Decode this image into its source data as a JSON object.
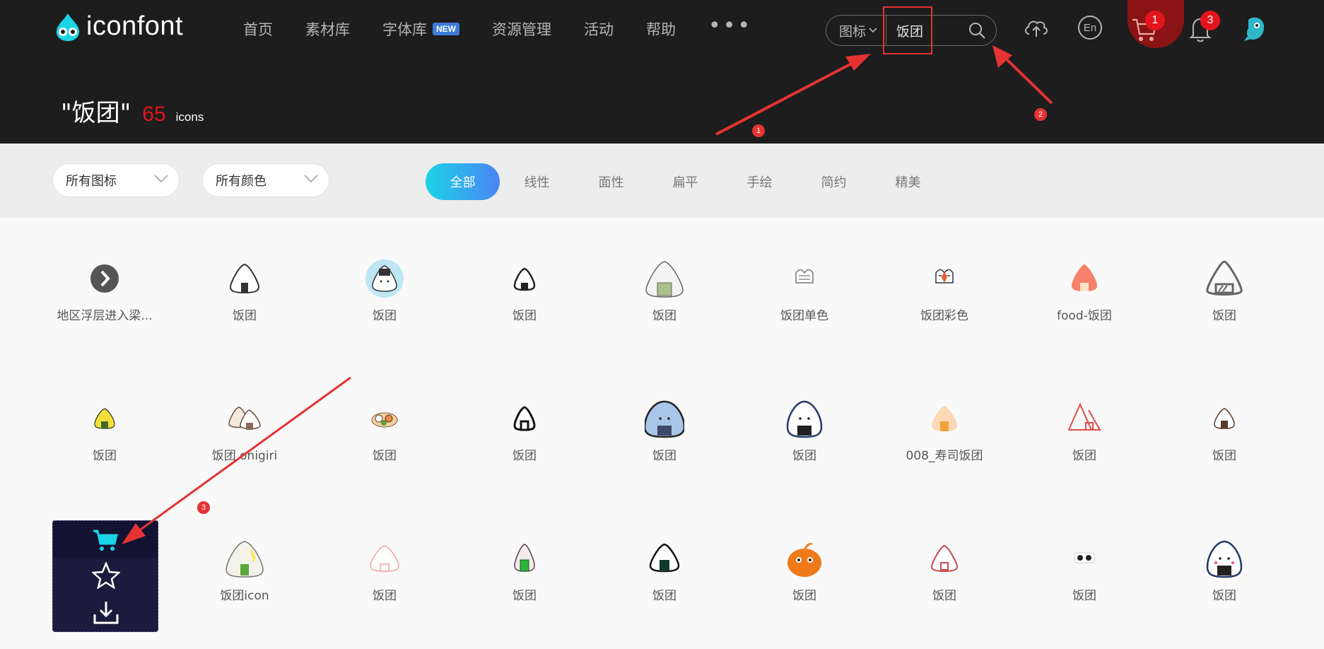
{
  "header": {
    "logo_text": "iconfont",
    "nav": [
      {
        "label": "首页"
      },
      {
        "label": "素材库"
      },
      {
        "label": "字体库",
        "badge": "NEW"
      },
      {
        "label": "资源管理"
      },
      {
        "label": "活动"
      },
      {
        "label": "帮助"
      }
    ],
    "more_label": "•••",
    "search": {
      "type_label": "图标",
      "value": "饭团"
    },
    "lang_label": "En",
    "cart_count": "1",
    "notification_count": "3"
  },
  "result": {
    "query": "\"饭团\"",
    "count": "65",
    "unit": "icons"
  },
  "annotations": [
    "1",
    "2",
    "3"
  ],
  "filters": {
    "type_dropdown": "所有图标",
    "color_dropdown": "所有颜色",
    "tabs": [
      "全部",
      "线性",
      "面性",
      "扁平",
      "手绘",
      "简约",
      "精美"
    ],
    "active_tab": "全部"
  },
  "icons": [
    {
      "label": "地区浮层进入梁..."
    },
    {
      "label": "饭团"
    },
    {
      "label": "饭团"
    },
    {
      "label": "饭团"
    },
    {
      "label": "饭团"
    },
    {
      "label": "饭团单色"
    },
    {
      "label": "饭团彩色"
    },
    {
      "label": "food-饭团"
    },
    {
      "label": "饭团"
    },
    {
      "label": "饭团"
    },
    {
      "label": "饭团 onigiri"
    },
    {
      "label": "饭团"
    },
    {
      "label": "饭团"
    },
    {
      "label": "饭团"
    },
    {
      "label": "饭团"
    },
    {
      "label": "008_寿司饭团"
    },
    {
      "label": "饭团"
    },
    {
      "label": "饭团"
    },
    {
      "label": ""
    },
    {
      "label": "饭团icon"
    },
    {
      "label": "饭团"
    },
    {
      "label": "饭团"
    },
    {
      "label": "饭团"
    },
    {
      "label": "饭团"
    },
    {
      "label": "饭团"
    },
    {
      "label": "饭团"
    },
    {
      "label": "饭团"
    }
  ],
  "colors": {
    "header_bg": "#1d1d1d",
    "accent_red": "#e3141c",
    "tab_gradient_start": "#1bd4e6",
    "tab_gradient_end": "#4a84f2",
    "hover_card_bg": "#1b1b3d",
    "hover_cart_icon": "#1bd4e6"
  }
}
